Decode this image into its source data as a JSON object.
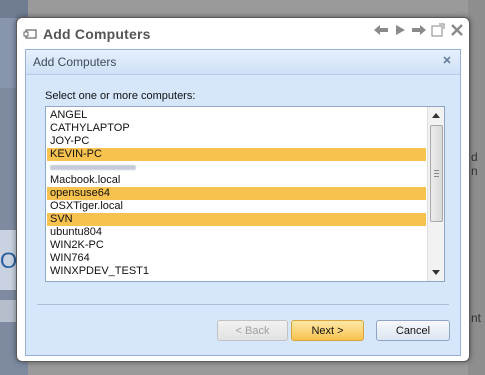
{
  "outer_window": {
    "title": "Add Computers"
  },
  "dialog": {
    "title": "Add Computers",
    "prompt": "Select one or more computers:",
    "computers": [
      {
        "name": "ANGEL",
        "selected": false
      },
      {
        "name": "CATHYLAPTOP",
        "selected": false
      },
      {
        "name": "JOY-PC",
        "selected": false
      },
      {
        "name": "KEVIN-PC",
        "selected": true
      },
      {
        "name": "",
        "selected": false,
        "obscured": true
      },
      {
        "name": "Macbook.local",
        "selected": false
      },
      {
        "name": "opensuse64",
        "selected": true
      },
      {
        "name": "OSXTiger.local",
        "selected": false
      },
      {
        "name": "SVN",
        "selected": true
      },
      {
        "name": "ubuntu804",
        "selected": false
      },
      {
        "name": "WIN2K-PC",
        "selected": false
      },
      {
        "name": "WIN764",
        "selected": false
      },
      {
        "name": "WINXPDEV_TEST1",
        "selected": false
      }
    ],
    "buttons": {
      "back": "< Back",
      "next": "Next >",
      "cancel": "Cancel"
    }
  },
  "background": {
    "right_text_1": "d n",
    "right_text_2": "nt",
    "left_letters": "OS"
  },
  "colors": {
    "selection": "#f7c24e",
    "dialog_bg": "#d6e6fb",
    "next_button": "#f7c24e"
  },
  "icons": {
    "window": "window-icon",
    "nav_back": "arrow-left-icon",
    "nav_forward": "arrow-right-icon",
    "nav_go": "arrow-forward-icon",
    "popout": "popout-icon",
    "close": "close-icon"
  }
}
